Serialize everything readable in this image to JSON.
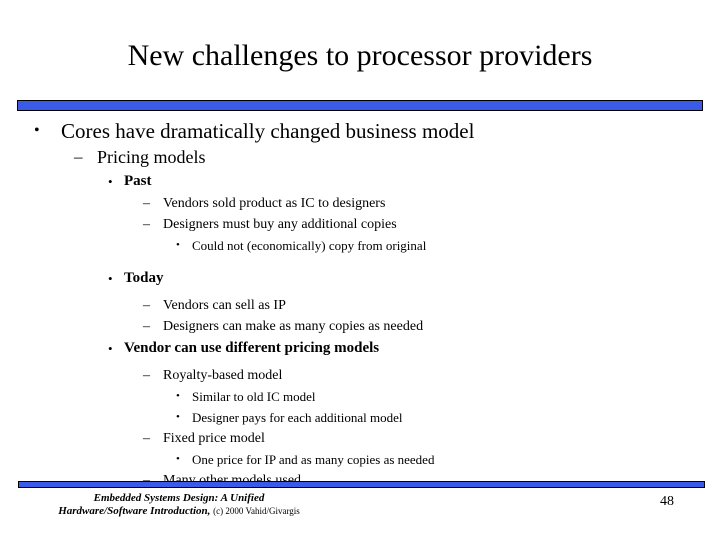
{
  "slide": {
    "title": "New challenges to processor providers",
    "number": "48"
  },
  "colors": {
    "rule_blue": "#3b5ae8",
    "rule_border": "#000000",
    "text": "#000000",
    "background": "#ffffff"
  },
  "markers": {
    "disc": "•",
    "dash": "–"
  },
  "body": {
    "lines": [
      {
        "level": 1,
        "marker": "•",
        "text": "Cores have dramatically changed business model"
      },
      {
        "level": 2,
        "marker": "–",
        "text": "Pricing models"
      },
      {
        "level": 3,
        "marker": "•",
        "text": "Past"
      },
      {
        "level": 4,
        "marker": "–",
        "text": "Vendors sold product as IC to designers"
      },
      {
        "level": 4,
        "marker": "–",
        "text": "Designers must buy any additional copies"
      },
      {
        "level": 5,
        "marker": "•",
        "text": "Could not (economically) copy from original"
      },
      {
        "level": 3,
        "marker": "•",
        "text": "Today"
      },
      {
        "level": 4,
        "marker": "–",
        "text": "Vendors can sell as IP"
      },
      {
        "level": 4,
        "marker": "–",
        "text": "Designers can make as many copies as needed"
      },
      {
        "level": 3,
        "marker": "•",
        "text": "Vendor can use different pricing models"
      },
      {
        "level": 4,
        "marker": "–",
        "text": "Royalty-based model"
      },
      {
        "level": 5,
        "marker": "•",
        "text": "Similar to old IC model"
      },
      {
        "level": 5,
        "marker": "•",
        "text": "Designer pays for each additional model"
      },
      {
        "level": 4,
        "marker": "–",
        "text": "Fixed price model"
      },
      {
        "level": 5,
        "marker": "•",
        "text": "One price for IP and as many copies as needed"
      },
      {
        "level": 4,
        "marker": "–",
        "text": "Many other models used"
      }
    ]
  },
  "footer": {
    "book_title_line1": "Embedded Systems Design: A Unified",
    "book_title_line2": "Hardware/Software Introduction,",
    "copyright": "(c) 2000 Vahid/Givargis"
  }
}
